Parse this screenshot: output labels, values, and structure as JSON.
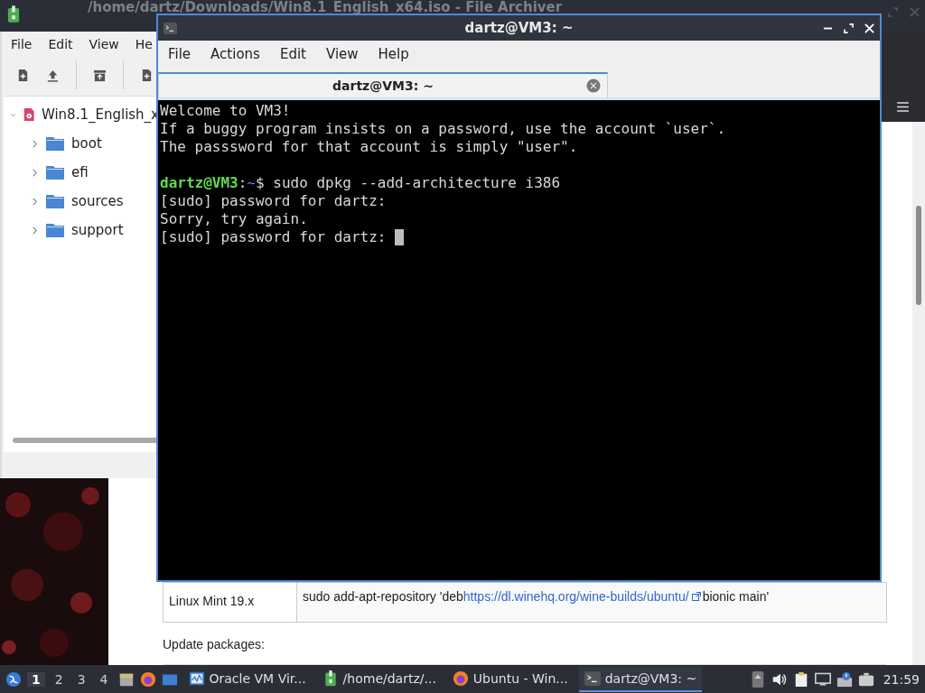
{
  "archiver": {
    "title": "/home/dartz/Downloads/Win8.1_English_x64.iso - File Archiver",
    "menu": [
      "File",
      "Edit",
      "View",
      "He"
    ],
    "tree": [
      {
        "label": "Win8.1_English_x",
        "expanded": true,
        "children": [
          {
            "label": "boot",
            "expanded": false
          },
          {
            "label": "efi",
            "expanded": false
          },
          {
            "label": "sources",
            "expanded": false
          },
          {
            "label": "support",
            "expanded": false
          }
        ]
      }
    ]
  },
  "browser": {
    "table_rows": [
      {
        "label": "Linux Mint 19.x",
        "command_before": "sudo add-apt-repository 'deb",
        "link": "https://dl.winehq.org/wine-builds/ubuntu/",
        "command_after": "bionic main'"
      }
    ],
    "heading": "Update packages:"
  },
  "terminal": {
    "title": "dartz@VM3: ~",
    "menu": [
      "File",
      "Actions",
      "Edit",
      "View",
      "Help"
    ],
    "tabs": [
      {
        "label": "dartz@VM3: ~",
        "selected": true
      }
    ],
    "lines": [
      {
        "kind": "text",
        "text": "Welcome to VM3!"
      },
      {
        "kind": "text",
        "text": "If a buggy program insists on a password, use the account `user`."
      },
      {
        "kind": "text",
        "text": "The passsword for that account is simply \"user\"."
      },
      {
        "kind": "blank"
      },
      {
        "kind": "prompt",
        "user": "dartz@VM3",
        "separator": ":",
        "path": "~",
        "symbol": "$",
        "command": " sudo dpkg --add-architecture i386"
      },
      {
        "kind": "text",
        "text": "[sudo] password for dartz:"
      },
      {
        "kind": "text",
        "text": "Sorry, try again."
      },
      {
        "kind": "text",
        "text": "[sudo] password for dartz: ",
        "cursor": true
      }
    ]
  },
  "taskbar": {
    "workspaces": [
      {
        "label": "1",
        "selected": true
      },
      {
        "label": "2",
        "selected": false
      },
      {
        "label": "3",
        "selected": false
      },
      {
        "label": "4",
        "selected": false
      }
    ],
    "tasks": [
      {
        "kind": "monitor",
        "label": "Oracle VM Vir...",
        "selected": false
      },
      {
        "kind": "archive",
        "label": "/home/dartz/...",
        "selected": false
      },
      {
        "kind": "browser",
        "label": "Ubuntu - Win...",
        "selected": false
      },
      {
        "kind": "terminal",
        "label": "dartz@VM3: ~",
        "selected": true
      }
    ],
    "clock": "21:59"
  }
}
